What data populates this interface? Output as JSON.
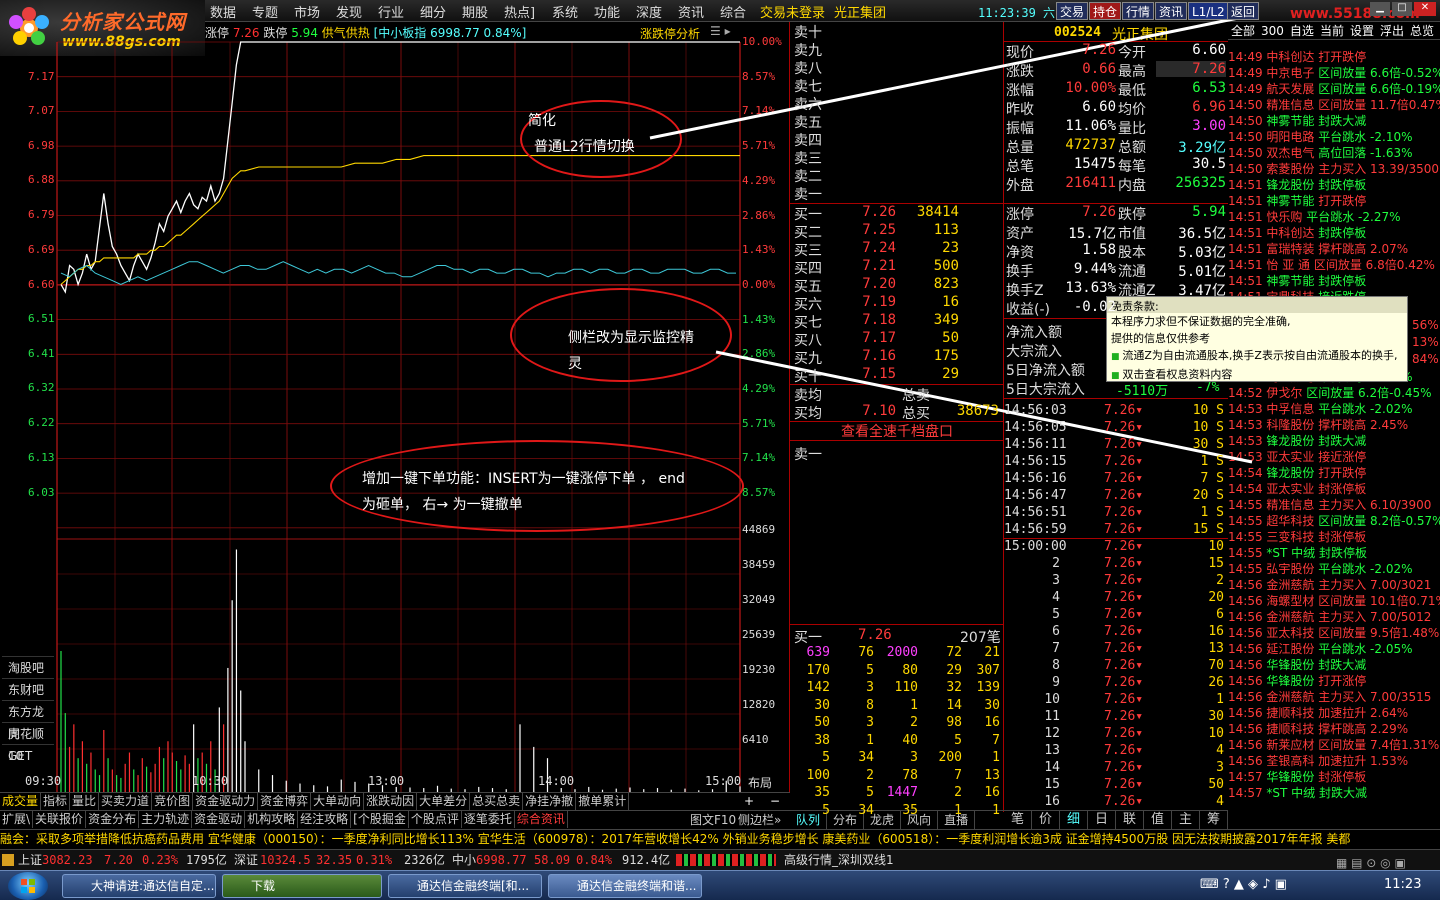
{
  "logo": {
    "title": "分析家公式网",
    "url": "www.88gs.com"
  },
  "menu": [
    "数据",
    "专题",
    "市场",
    "发现",
    "行业",
    "细分",
    "期股",
    "热点]",
    "系统",
    "功能",
    "深度",
    "资讯",
    "综合"
  ],
  "login_status": "交易未登录",
  "broker": "光正集团",
  "clock": "11:23:39 六",
  "top_buttons": [
    "交易",
    "持仓",
    "行情",
    "资讯",
    "L1/L2",
    "返回"
  ],
  "watermark": "www.55188.com",
  "chart_header": {
    "limit_up_label": "涨停",
    "limit_up": "7.26",
    "limit_down_label": "跌停",
    "limit_down": "5.94",
    "supply": "供气供热",
    "index_label": "[中小板指 6998.77 0.84%]",
    "analysis": "涨跌停分析"
  },
  "chart_data": {
    "type": "line",
    "price_axis": [
      "7.17",
      "7.07",
      "6.98",
      "6.88",
      "6.79",
      "6.69",
      "6.60",
      "6.51",
      "6.41",
      "6.32",
      "6.22",
      "6.13",
      "6.03"
    ],
    "pct_axis": [
      "10.00%",
      "8.57%",
      "7.14%",
      "5.71%",
      "4.29%",
      "2.86%",
      "1.43%",
      "0.00%",
      "1.43%",
      "2.86%",
      "4.29%",
      "5.71%",
      "7.14%",
      "8.57%"
    ],
    "vol_axis": [
      "44869",
      "38459",
      "32049",
      "25639",
      "19230",
      "12820",
      "6410"
    ],
    "time_axis": [
      "09:30",
      "10:30",
      "13:00",
      "14:00",
      "15:00"
    ],
    "prev_close": 6.6,
    "price": [
      6.62,
      6.6,
      6.67,
      6.66,
      6.62,
      6.65,
      6.7,
      6.66,
      6.68,
      6.77,
      6.86,
      6.78,
      6.72,
      6.7,
      6.67,
      6.65,
      6.63,
      6.67,
      6.7,
      6.68,
      6.66,
      6.69,
      6.73,
      6.78,
      6.76,
      6.8,
      6.82,
      6.84,
      6.81,
      6.84,
      6.86,
      6.83,
      6.82,
      6.85,
      6.84,
      6.88,
      6.84,
      6.86,
      6.9,
      7.0,
      7.1,
      7.2,
      7.26,
      7.26,
      7.26,
      7.26,
      7.26,
      7.26,
      7.26,
      7.26,
      7.26,
      7.26,
      7.26,
      7.26,
      7.26,
      7.26,
      7.26,
      7.26,
      7.26,
      7.26,
      7.26,
      7.26,
      7.26,
      7.26,
      7.26,
      7.26,
      7.26,
      7.26,
      7.26,
      7.26,
      7.26,
      7.26,
      7.26,
      7.26,
      7.26,
      7.26,
      7.26,
      7.26,
      7.26,
      7.26
    ],
    "avg_price": [
      6.62,
      6.63,
      6.64,
      6.65,
      6.66,
      6.66,
      6.67,
      6.67,
      6.68,
      6.68,
      6.69,
      6.69,
      6.69,
      6.69,
      6.69,
      6.69,
      6.69,
      6.69,
      6.7,
      6.7,
      6.7,
      6.71,
      6.71,
      6.72,
      6.72,
      6.73,
      6.74,
      6.75,
      6.75,
      6.76,
      6.77,
      6.78,
      6.79,
      6.8,
      6.81,
      6.82,
      6.83,
      6.84,
      6.86,
      6.88,
      6.9,
      6.91,
      6.92,
      6.92,
      6.93,
      6.93,
      6.93,
      6.93,
      6.93,
      6.93,
      6.93,
      6.94,
      6.94,
      6.94,
      6.95,
      6.95,
      6.96,
      6.96,
      6.96,
      6.96,
      6.96,
      6.96,
      6.96,
      6.96,
      6.96,
      6.96,
      6.96,
      6.96,
      6.96,
      6.96,
      6.96,
      6.96,
      6.96,
      6.96,
      6.96,
      6.96,
      6.96,
      6.96,
      6.96,
      6.96
    ],
    "index_line": [
      6.65,
      6.64,
      6.66,
      6.67,
      6.65,
      6.64,
      6.63,
      6.62,
      6.63,
      6.64,
      6.63,
      6.64,
      6.65,
      6.66,
      6.67,
      6.68,
      6.68,
      6.67,
      6.66,
      6.65,
      6.66,
      6.67,
      6.67,
      6.66,
      6.66,
      6.67,
      6.68,
      6.67,
      6.66,
      6.65,
      6.66,
      6.65,
      6.66,
      6.66,
      6.65,
      6.66,
      6.67,
      6.66,
      6.65,
      6.65,
      6.64,
      6.64,
      6.65,
      6.66,
      6.67,
      6.67,
      6.66,
      6.66,
      6.65,
      6.66,
      6.66,
      6.65,
      6.65,
      6.66,
      6.66,
      6.65,
      6.65,
      6.64,
      6.65,
      6.65,
      6.66,
      6.66,
      6.65,
      6.66,
      6.66,
      6.65,
      6.65,
      6.66,
      6.66,
      6.65,
      6.65,
      6.66,
      6.66,
      6.66,
      6.65,
      6.65,
      6.66,
      6.66,
      6.65,
      6.65
    ],
    "volume": [
      25000,
      14000,
      8000,
      12000,
      6000,
      9000,
      5000,
      7000,
      4000,
      3000,
      11000,
      6000,
      4000,
      3000,
      2500,
      5000,
      7000,
      4000,
      3000,
      6000,
      4500,
      3500,
      5000,
      8000,
      6000,
      9000,
      7000,
      5500,
      4000,
      6500,
      5000,
      12000,
      6000,
      7000,
      5000,
      9000,
      4000,
      15000,
      12000,
      22000,
      34000,
      43000,
      18000,
      9000,
      4000,
      3000,
      2000,
      1500,
      1200,
      1000,
      2200,
      1800,
      1500,
      1200,
      900,
      800,
      700,
      1100,
      600,
      500,
      900,
      700,
      500,
      12000,
      8000,
      6000,
      700,
      500,
      900,
      400,
      600,
      800,
      500,
      700,
      400,
      600,
      300,
      500,
      2000,
      1000
    ],
    "volume_colors": [
      "g",
      "g",
      "r",
      "r",
      "g",
      "r",
      "g",
      "r",
      "g",
      "g",
      "r",
      "g",
      "r",
      "g",
      "g",
      "r",
      "r",
      "g",
      "r",
      "r",
      "g",
      "r",
      "r",
      "r",
      "g",
      "r",
      "r",
      "g",
      "g",
      "r",
      "r",
      "w",
      "g",
      "r",
      "g",
      "r",
      "g",
      "w",
      "r",
      "w",
      "w",
      "w",
      "w",
      "w",
      "w",
      "w",
      "w",
      "w",
      "w",
      "w",
      "w",
      "w",
      "w",
      "w",
      "w",
      "w",
      "w",
      "w",
      "w",
      "w",
      "w",
      "w",
      "w",
      "w",
      "w",
      "w",
      "w",
      "w",
      "w",
      "w",
      "w",
      "w",
      "w",
      "w",
      "w",
      "w",
      "w",
      "w",
      "w",
      "w"
    ]
  },
  "side_links": [
    "淘股吧",
    "东财吧",
    "东方龙虎",
    "同花顺10",
    "GET"
  ],
  "layout_label": "布局",
  "bottom_tabs": [
    "成交量",
    "指标",
    "量比",
    "买卖力道",
    "竞价图",
    "资金驱动力",
    "资金博弈",
    "大单动向",
    "涨跌动因",
    "大单差分",
    "总买总卖",
    "净挂净撤",
    "撤单累计"
  ],
  "bottom_tabs2": [
    "扩展\\",
    "关联报价",
    "资金分布",
    "主力轨迹",
    "资金驱动",
    "机构攻略",
    "经注攻略",
    "[个股掘金",
    "个股点评",
    "逐笔委托",
    "综合资讯"
  ],
  "bottom_right": [
    "图文F10",
    "侧边栏»"
  ],
  "annotations": [
    {
      "lines": [
        "简化",
        "普通L2行情切换"
      ]
    },
    {
      "lines": [
        "侧栏改为显示监控精",
        "灵"
      ]
    },
    {
      "lines": [
        "增加一键下单功能：INSERT为一键涨停下单 ，   end",
        "为砸单，    右→ 为一键撤单"
      ]
    }
  ],
  "stock_header": {
    "code": "002524",
    "name": "光正集团"
  },
  "asks": [
    {
      "label": "卖十"
    },
    {
      "label": "卖九"
    },
    {
      "label": "卖八"
    },
    {
      "label": "卖七"
    },
    {
      "label": "卖六"
    },
    {
      "label": "卖五"
    },
    {
      "label": "卖四"
    },
    {
      "label": "卖三"
    },
    {
      "label": "卖二"
    },
    {
      "label": "卖一"
    }
  ],
  "bids": [
    {
      "label": "买一",
      "price": "7.26",
      "vol": "38414"
    },
    {
      "label": "买二",
      "price": "7.25",
      "vol": "113"
    },
    {
      "label": "买三",
      "price": "7.24",
      "vol": "23"
    },
    {
      "label": "买四",
      "price": "7.21",
      "vol": "500"
    },
    {
      "label": "买五",
      "price": "7.20",
      "vol": "823"
    },
    {
      "label": "买六",
      "price": "7.19",
      "vol": "16"
    },
    {
      "label": "买七",
      "price": "7.18",
      "vol": "349"
    },
    {
      "label": "买八",
      "price": "7.17",
      "vol": "50"
    },
    {
      "label": "买九",
      "price": "7.16",
      "vol": "175"
    },
    {
      "label": "买十",
      "price": "7.15",
      "vol": "29"
    }
  ],
  "avg_rows": [
    {
      "label": "卖均",
      "price": "",
      "mid": "总卖",
      "vol": ""
    },
    {
      "label": "买均",
      "price": "7.10",
      "mid": "总买",
      "vol": "38673"
    }
  ],
  "depth_link": "查看全速千档盘口",
  "ask1_queue": "卖一",
  "bid1_queue": {
    "label": "买一",
    "price": "7.26",
    "count": "207笔"
  },
  "bid_queue": [
    [
      "639",
      "76",
      "2000",
      "72",
      "21"
    ],
    [
      "170",
      "5",
      "80",
      "29",
      "307"
    ],
    [
      "142",
      "3",
      "110",
      "32",
      "139"
    ],
    [
      "30",
      "8",
      "1",
      "14",
      "30"
    ],
    [
      "50",
      "3",
      "2",
      "98",
      "16"
    ],
    [
      "38",
      "1",
      "40",
      "5",
      "7"
    ],
    [
      "5",
      "34",
      "3",
      "200",
      "1"
    ],
    [
      "100",
      "2",
      "78",
      "7",
      "13"
    ],
    [
      "35",
      "5",
      "1447",
      "2",
      "16"
    ],
    [
      "5",
      "34",
      "35",
      "1",
      "1"
    ]
  ],
  "mid_tabs": [
    "队列",
    "分布",
    "龙虎",
    "风向",
    "直播"
  ],
  "quote": [
    {
      "a": "现价",
      "b": "7.26",
      "bc": "r",
      "c": "今开",
      "d": "6.60",
      "dc": "w"
    },
    {
      "a": "涨跌",
      "b": "0.66",
      "bc": "r",
      "c": "最高",
      "d": "7.26",
      "dc": "rb"
    },
    {
      "a": "涨幅",
      "b": "10.00%",
      "bc": "r",
      "c": "最低",
      "d": "6.53",
      "dc": "g"
    },
    {
      "a": "昨收",
      "b": "6.60",
      "bc": "w",
      "c": "均价",
      "d": "6.96",
      "dc": "r"
    },
    {
      "a": "振幅",
      "b": "11.06%",
      "bc": "w",
      "c": "量比",
      "d": "3.00",
      "dc": "m"
    },
    {
      "a": "总量",
      "b": "472737",
      "bc": "y",
      "c": "总额",
      "d": "3.29亿",
      "dc": "c"
    },
    {
      "a": "总笔",
      "b": "15475",
      "bc": "w",
      "c": "每笔",
      "d": "30.5",
      "dc": "w"
    },
    {
      "a": "外盘",
      "b": "216411",
      "bc": "r",
      "c": "内盘",
      "d": "256325",
      "dc": "g"
    },
    {
      "a": "涨停",
      "b": "7.26",
      "bc": "r",
      "c": "跌停",
      "d": "5.94",
      "dc": "g"
    },
    {
      "a": "资产",
      "b": "15.7亿",
      "bc": "w",
      "c": "市值",
      "d": "36.5亿",
      "dc": "w"
    },
    {
      "a": "净资",
      "b": "1.58",
      "bc": "w",
      "c": "股本",
      "d": "5.03亿",
      "dc": "w"
    },
    {
      "a": "换手",
      "b": "9.44%",
      "bc": "w",
      "c": "流通",
      "d": "5.01亿",
      "dc": "w"
    },
    {
      "a": "换手Z",
      "b": "13.63%",
      "bc": "w",
      "c": "流通Z",
      "d": "3.47亿",
      "dc": "w"
    },
    {
      "a": "收益(-)",
      "b": "-0.02",
      "bc": "w",
      "c": "",
      "d": "",
      "dc": "w"
    }
  ],
  "flows": [
    "净流入额",
    "大宗流入",
    "5日净流入额",
    "5日大宗流入"
  ],
  "flow_tail": {
    "value": "-5110万",
    "pct": "-7%"
  },
  "popup": {
    "title": "免责条款:",
    "lines": [
      "本程序力求但不保证数据的完全准确,",
      "提供的信息仅供参考",
      "流通Z为自由流通股本,换手Z表示按自由流通股本的换手,",
      "双击查看权息资料内容"
    ]
  },
  "ticks": [
    {
      "t": "14:56:03",
      "p": "7.26",
      "v": "10 S"
    },
    {
      "t": "14:56:05",
      "p": "7.26",
      "v": "10 S"
    },
    {
      "t": "14:56:11",
      "p": "7.26",
      "v": "30 S"
    },
    {
      "t": "14:56:15",
      "p": "7.26",
      "v": "1 S"
    },
    {
      "t": "14:56:16",
      "p": "7.26",
      "v": "7 S"
    },
    {
      "t": "14:56:47",
      "p": "7.26",
      "v": "20 S"
    },
    {
      "t": "14:56:51",
      "p": "7.26",
      "v": "1 S"
    },
    {
      "t": "14:56:59",
      "p": "7.26",
      "v": "15 S"
    },
    {
      "t": "15:00:00",
      "p": "7.26",
      "v": "10"
    },
    {
      "t": "2",
      "p": "7.26",
      "v": "15"
    },
    {
      "t": "3",
      "p": "7.26",
      "v": "2"
    },
    {
      "t": "4",
      "p": "7.26",
      "v": "20"
    },
    {
      "t": "5",
      "p": "7.26",
      "v": "6"
    },
    {
      "t": "6",
      "p": "7.26",
      "v": "16"
    },
    {
      "t": "7",
      "p": "7.26",
      "v": "13"
    },
    {
      "t": "8",
      "p": "7.26",
      "v": "70"
    },
    {
      "t": "9",
      "p": "7.26",
      "v": "26"
    },
    {
      "t": "10",
      "p": "7.26",
      "v": "1"
    },
    {
      "t": "11",
      "p": "7.26",
      "v": "30"
    },
    {
      "t": "12",
      "p": "7.26",
      "v": "10"
    },
    {
      "t": "13",
      "p": "7.26",
      "v": "4"
    },
    {
      "t": "14",
      "p": "7.26",
      "v": "3"
    },
    {
      "t": "15",
      "p": "7.26",
      "v": "50"
    },
    {
      "t": "16",
      "p": "7.26",
      "v": "4"
    }
  ],
  "right_tabs": [
    "笔",
    "价",
    "细",
    "日",
    "联",
    "值",
    "主",
    "筹"
  ],
  "monitor_tabs": [
    "全部",
    "300",
    "自选",
    "当前",
    "设置",
    "浮出",
    "总览"
  ],
  "monitor": [
    {
      "t": "14:49",
      "n": "中科创达",
      "e": "打开跌停",
      "ec": "r"
    },
    {
      "t": "14:49",
      "n": "中京电子",
      "e": "区间放量 6.6倍-0.52%",
      "ec": "g"
    },
    {
      "t": "14:49",
      "n": "航天发展",
      "e": "区间放量 6.6倍-0.19%",
      "ec": "g"
    },
    {
      "t": "14:50",
      "n": "精准信息",
      "e": "区间放量 11.7倍0.47%",
      "ec": "r"
    },
    {
      "t": "14:50",
      "n": "神雾节能",
      "e": "封跌大减",
      "ec": "g",
      "ng": true
    },
    {
      "t": "14:50",
      "n": "明阳电路",
      "e": "平台跳水 -2.10%",
      "ec": "g"
    },
    {
      "t": "14:50",
      "n": "双杰电气",
      "e": "高位回落 -1.63%",
      "ec": "g"
    },
    {
      "t": "14:50",
      "n": "索菱股份",
      "e": "主力买入 13.39/3500",
      "ec": "r"
    },
    {
      "t": "14:51",
      "n": "锋龙股份",
      "e": "封跌停板",
      "ec": "g",
      "ng": true
    },
    {
      "t": "14:51",
      "n": "神雾节能",
      "e": "打开跌停",
      "ec": "r",
      "ng": true
    },
    {
      "t": "14:51",
      "n": "快乐购",
      "e": "平台跳水 -2.27%",
      "ec": "g"
    },
    {
      "t": "14:51",
      "n": "中科创达",
      "e": "封跌停板",
      "ec": "g"
    },
    {
      "t": "14:51",
      "n": "富瑞特装",
      "e": "撑杆跳高 2.07%",
      "ec": "r"
    },
    {
      "t": "14:51",
      "n": "怡 亚 通",
      "e": "区间放量 6.8倍0.42%",
      "ec": "r"
    },
    {
      "t": "14:51",
      "n": "神雾节能",
      "e": "封跌停板",
      "ec": "g",
      "ng": true
    },
    {
      "t": "14:51",
      "n": "宝鼎科技",
      "e": "接近跌停",
      "ec": "g"
    },
    {
      "t": "",
      "n": "",
      "e": "",
      "ec": "g"
    },
    {
      "t": "",
      "n": "",
      "e": "",
      "ec": "g"
    },
    {
      "t": "",
      "n": "",
      "e": "",
      "ec": "g"
    },
    {
      "t": "",
      "n": "",
      "e": "",
      "ec": "g"
    },
    {
      "t": "14:52",
      "n": "创业黑马",
      "e": "平台跳水 -3.31%",
      "ec": "g"
    },
    {
      "t": "14:52",
      "n": "伊戈尔",
      "e": "区间放量 6.2倍-0.45%",
      "ec": "g"
    },
    {
      "t": "14:53",
      "n": "中孚信息",
      "e": "平台跳水 -2.02%",
      "ec": "g"
    },
    {
      "t": "14:53",
      "n": "科隆股份",
      "e": "撑杆跳高 2.45%",
      "ec": "r"
    },
    {
      "t": "14:53",
      "n": "锋龙股份",
      "e": "封跌大减",
      "ec": "g",
      "ng": true
    },
    {
      "t": "14:53",
      "n": "亚太实业",
      "e": "接近涨停",
      "ec": "r"
    },
    {
      "t": "14:54",
      "n": "锋龙股份",
      "e": "打开跌停",
      "ec": "r",
      "ng": true
    },
    {
      "t": "14:54",
      "n": "亚太实业",
      "e": "封涨停板",
      "ec": "r"
    },
    {
      "t": "14:55",
      "n": "精准信息",
      "e": "主力买入 6.10/3900",
      "ec": "r"
    },
    {
      "t": "14:55",
      "n": "超华科技",
      "e": "区间放量 8.2倍-0.57%",
      "ec": "g"
    },
    {
      "t": "14:55",
      "n": "三变科技",
      "e": "封涨停板",
      "ec": "r"
    },
    {
      "t": "14:55",
      "n": "*ST 中绒",
      "e": "封跌停板",
      "ec": "g",
      "ng": true
    },
    {
      "t": "14:55",
      "n": "弘宇股份",
      "e": "平台跳水 -2.02%",
      "ec": "g"
    },
    {
      "t": "14:56",
      "n": "金洲慈航",
      "e": "主力买入 7.00/3021",
      "ec": "r"
    },
    {
      "t": "14:56",
      "n": "海螺型材",
      "e": "区间放量 10.1倍0.71%",
      "ec": "r"
    },
    {
      "t": "14:56",
      "n": "金洲慈航",
      "e": "主力买入 7.00/5012",
      "ec": "r"
    },
    {
      "t": "14:56",
      "n": "亚太科技",
      "e": "区间放量 9.5倍1.48%",
      "ec": "r"
    },
    {
      "t": "14:56",
      "n": "延江股份",
      "e": "平台跳水 -2.05%",
      "ec": "g"
    },
    {
      "t": "14:56",
      "n": "华锋股份",
      "e": "封跌大减",
      "ec": "g",
      "ng": true
    },
    {
      "t": "14:56",
      "n": "华锋股份",
      "e": "打开涨停",
      "ec": "r",
      "ng": true
    },
    {
      "t": "14:56",
      "n": "金洲慈航",
      "e": "主力买入 7.00/3515",
      "ec": "r"
    },
    {
      "t": "14:56",
      "n": "捷顺科技",
      "e": "加速拉升 2.64%",
      "ec": "r"
    },
    {
      "t": "14:56",
      "n": "捷顺科技",
      "e": "撑杆跳高 2.29%",
      "ec": "r"
    },
    {
      "t": "14:56",
      "n": "新莱应材",
      "e": "区间放量 7.4倍1.31%",
      "ec": "r"
    },
    {
      "t": "14:56",
      "n": "荃银高科",
      "e": "加速拉升 1.53%",
      "ec": "r"
    },
    {
      "t": "14:57",
      "n": "华锋股份",
      "e": "封涨停板",
      "ec": "r",
      "ng": true
    },
    {
      "t": "14:57",
      "n": "*ST 中绒",
      "e": "封跌大减",
      "ec": "g",
      "ng": true
    }
  ],
  "monitor_right_pcts": [
    "56%",
    "13%",
    "84%"
  ],
  "ticker": "融会：采取多项举措降低抗癌药品费用       宜华健康（000150）：一季度净利同比增长113%       宜华生活（600978）：2017年营收增长42% 外销业务稳步增长       康美药业（600518）：一季度利润增长逾3成  证金增持4500万股       因无法按期披露2017年年报  美都",
  "indices": {
    "sh_label": "上证",
    "sh": "3082.23",
    "sh_chg": "7.20",
    "sh_pct": "0.23%",
    "sh_amt": "1795亿",
    "sz_label": "深证",
    "sz": "10324.5",
    "sz_chg": "32.35",
    "sz_pct": "0.31%",
    "sz_amt": "2326亿",
    "zx_label": "中小",
    "zx": "6998.77",
    "zx_chg": "58.09",
    "zx_pct": "0.84%",
    "zx_amt": "912.4亿",
    "feed": "高级行情_深圳双线1"
  },
  "taskbar": {
    "tasks": [
      "大神请进:通达信自定...",
      "下载",
      "通达信金融终端[和...",
      "通达信金融终端和谐..."
    ],
    "time": "11:23"
  }
}
